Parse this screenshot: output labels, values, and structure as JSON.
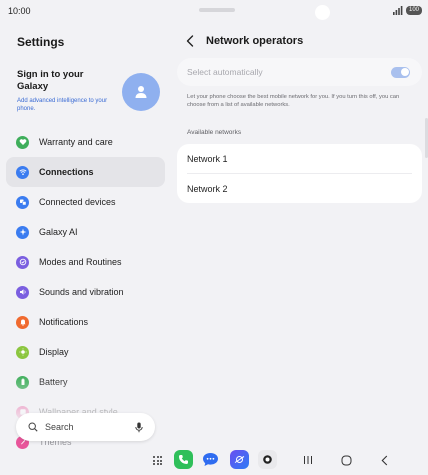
{
  "status_bar": {
    "time": "10:00",
    "battery": "100"
  },
  "settings": {
    "title": "Settings",
    "account": {
      "title": "Sign in to your Galaxy",
      "subtitle": "Add advanced intelligence to your phone."
    },
    "menu": [
      {
        "label": "Warranty and care",
        "icon": "heart-icon",
        "color": "#3fae5b"
      },
      {
        "label": "Connections",
        "icon": "wifi-icon",
        "color": "#3b7cf0",
        "active": true
      },
      {
        "label": "Connected devices",
        "icon": "devices-icon",
        "color": "#3b7cf0"
      },
      {
        "label": "Galaxy AI",
        "icon": "sparkle-icon",
        "color": "#3b7cf0"
      },
      {
        "label": "Modes and Routines",
        "icon": "check-circle-icon",
        "color": "#7b5fe0"
      },
      {
        "label": "Sounds and vibration",
        "icon": "speaker-icon",
        "color": "#7b5fe0"
      },
      {
        "label": "Notifications",
        "icon": "bell-icon",
        "color": "#f06a2f"
      },
      {
        "label": "Display",
        "icon": "sun-icon",
        "color": "#8cc63f"
      },
      {
        "label": "Battery",
        "icon": "battery-icon",
        "color": "#3fae5b"
      },
      {
        "label": "Wallpaper and style",
        "icon": "palette-icon",
        "color": "#e8559a"
      },
      {
        "label": "Themes",
        "icon": "brush-icon",
        "color": "#e8559a"
      }
    ],
    "search_label": "Search"
  },
  "network_operators": {
    "title": "Network operators",
    "select_automatically": "Select automatically",
    "select_automatically_on": true,
    "description": "Let your phone choose the best mobile network for you. If you turn this off, you can choose from a list of available networks.",
    "available_label": "Available networks",
    "networks": [
      "Network 1",
      "Network 2"
    ]
  },
  "colors": {
    "accent": "#3b7cf0",
    "toggle_disabled": "#a9c0ee",
    "background": "#f2f2f5"
  }
}
